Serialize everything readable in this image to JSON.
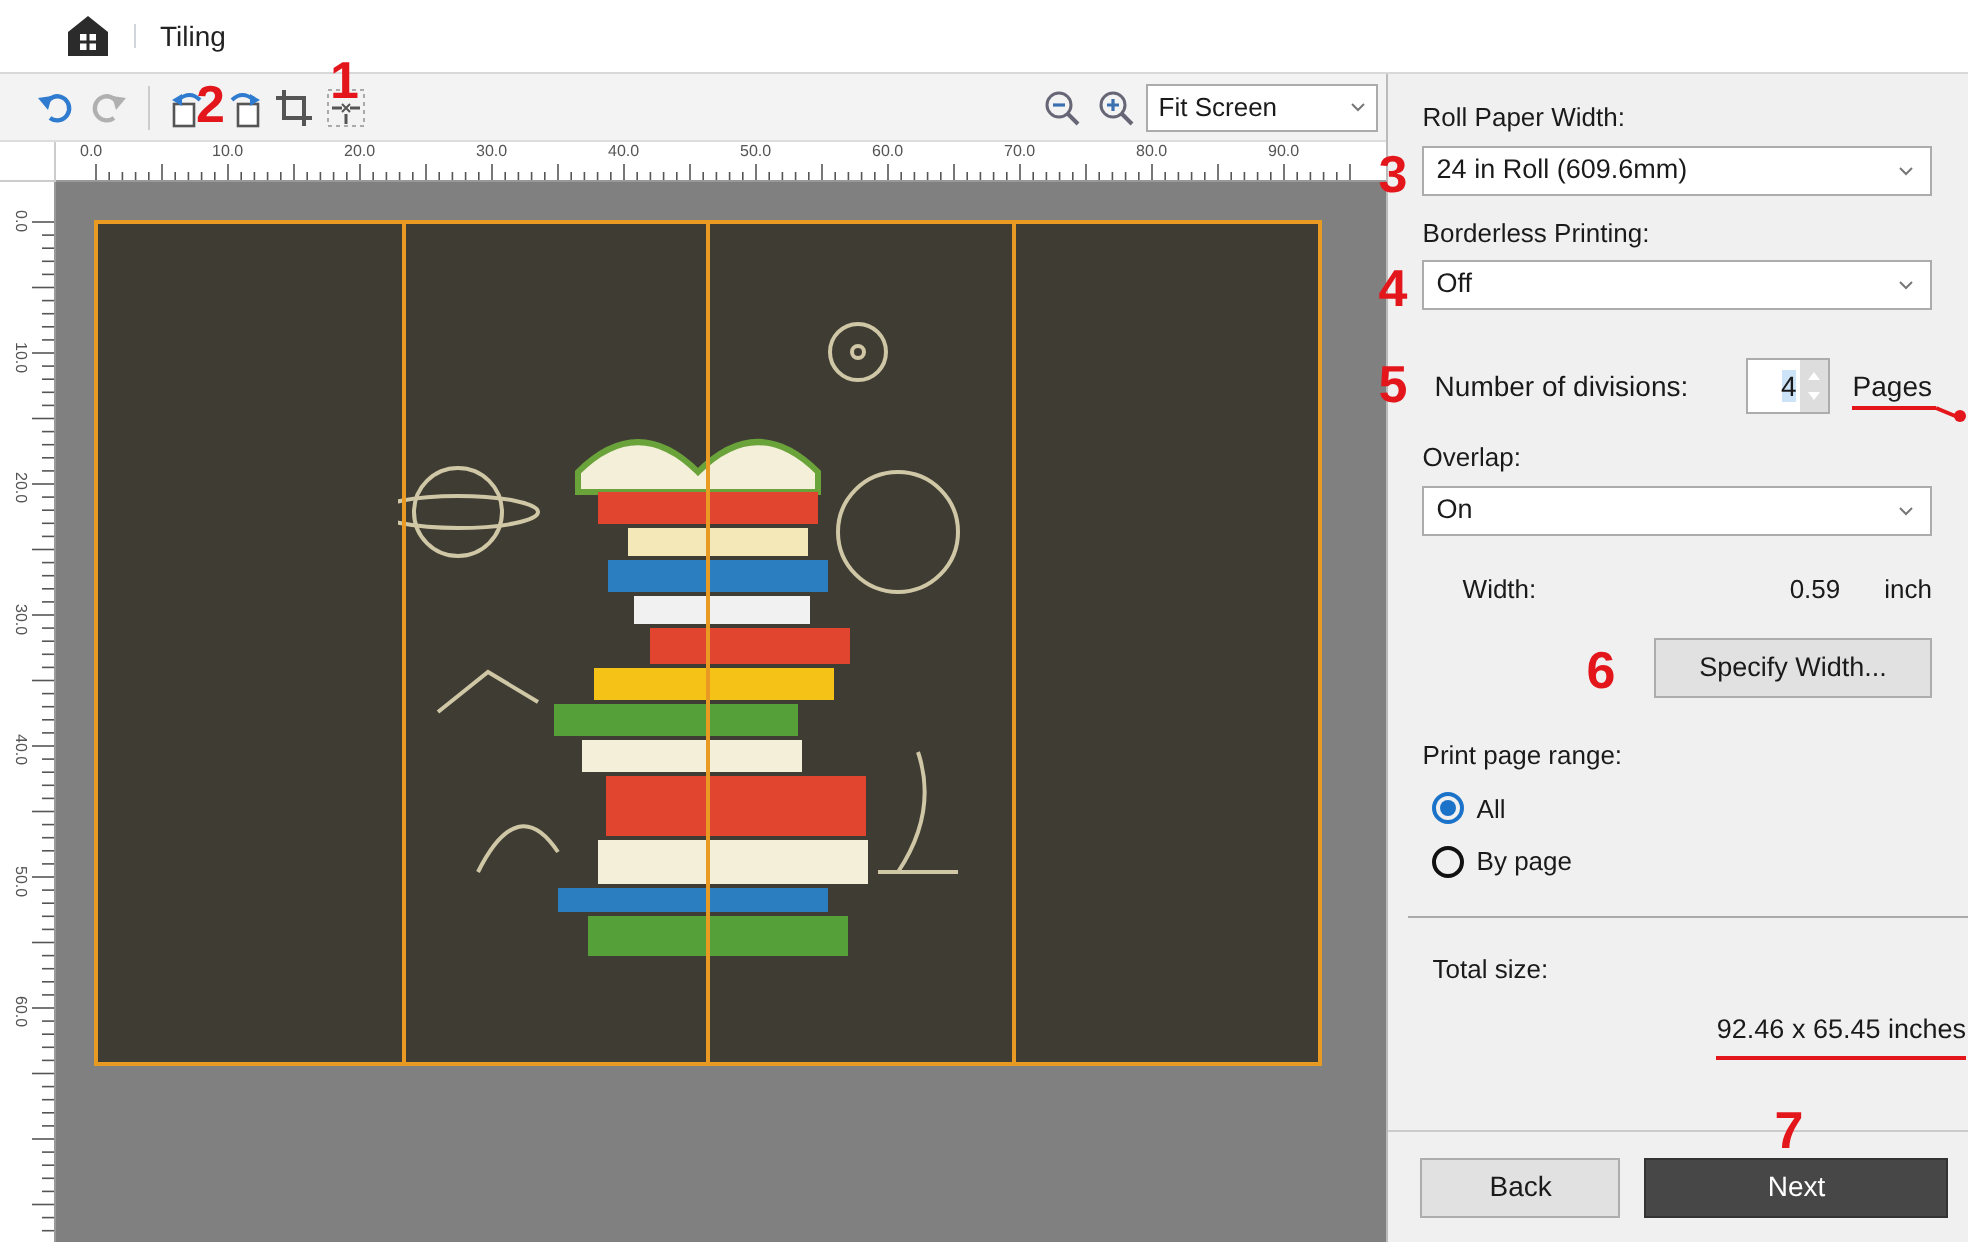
{
  "header": {
    "title": "Tiling"
  },
  "toolbar": {
    "buttons": [
      {
        "kind": "undo",
        "disabled": false
      },
      {
        "kind": "redo",
        "disabled": true
      },
      {
        "kind": "rotate-left",
        "badge": "2"
      },
      {
        "kind": "rotate-right"
      },
      {
        "kind": "crop"
      },
      {
        "kind": "fit",
        "badge": "1"
      }
    ],
    "zoom": {
      "value": "Fit Screen"
    }
  },
  "ruler": {
    "horizontal": [
      "0.0",
      "10.0",
      "20.0",
      "30.0",
      "40.0",
      "50.0",
      "60.0",
      "70.0",
      "80.0",
      "90.0"
    ],
    "vertical": [
      "0.0",
      "10.0",
      "20.0",
      "30.0",
      "40.0",
      "50.0",
      "60.0"
    ]
  },
  "panel": {
    "roll_paper_width": {
      "label": "Roll Paper Width:",
      "value": "24 in Roll (609.6mm)",
      "badge": "3"
    },
    "borderless": {
      "label": "Borderless Printing:",
      "value": "Off",
      "badge": "4"
    },
    "divisions": {
      "label": "Number of divisions:",
      "value": "4",
      "unit": "Pages",
      "badge": "5",
      "underlined": true
    },
    "overlap": {
      "label": "Overlap:",
      "value": "On"
    },
    "width": {
      "label": "Width:",
      "value": "0.59",
      "unit": "inch"
    },
    "specify_button": {
      "label": "Specify Width...",
      "badge": "6"
    },
    "page_range": {
      "label": "Print page range:",
      "options": [
        {
          "label": "All",
          "selected": true
        },
        {
          "label": "By page",
          "selected": false
        }
      ]
    },
    "total_size": {
      "label": "Total size:",
      "value": "92.46 x 65.45 inches",
      "underlined": true
    }
  },
  "footer": {
    "buttons": [
      {
        "label": "Back",
        "kind": "secondary"
      },
      {
        "label": "Next",
        "kind": "primary",
        "badge": "7"
      }
    ]
  }
}
